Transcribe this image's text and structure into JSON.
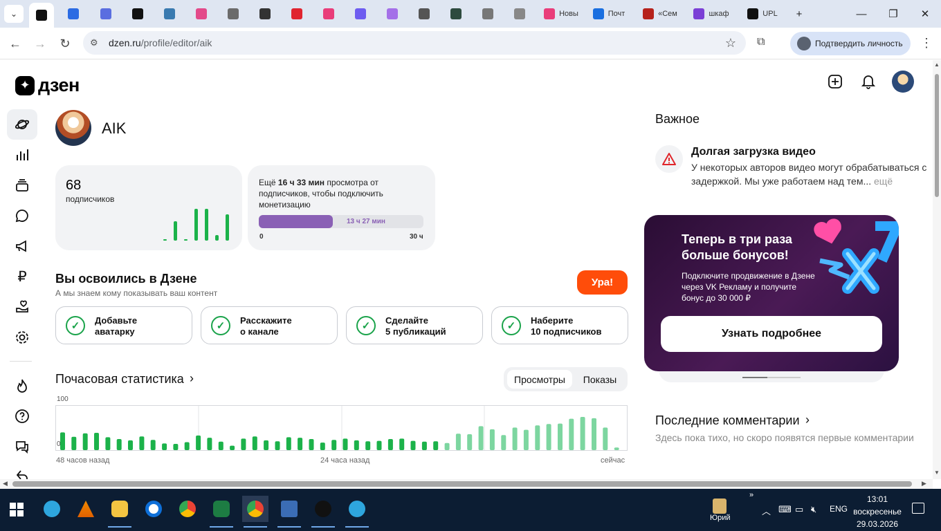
{
  "browser": {
    "tabs": [
      {
        "label": "",
        "color": "#111111"
      },
      {
        "label": "",
        "color": "#2b6be3"
      },
      {
        "label": "",
        "color": "#5a6ee0"
      },
      {
        "label": "",
        "color": "#111111"
      },
      {
        "label": "",
        "color": "#3a7ab0"
      },
      {
        "label": "",
        "color": "#e34a8a"
      },
      {
        "label": "",
        "color": "#6b6b6b"
      },
      {
        "label": "",
        "color": "#333333"
      },
      {
        "label": "",
        "color": "#e0242f"
      },
      {
        "label": "",
        "color": "#e93d7a"
      },
      {
        "label": "",
        "color": "#6d5cf0"
      },
      {
        "label": "",
        "color": "#a470e8"
      },
      {
        "label": "",
        "color": "#555555"
      },
      {
        "label": "",
        "color": "#2e4b3f"
      },
      {
        "label": "",
        "color": "#777777"
      },
      {
        "label": "",
        "color": "#888888"
      },
      {
        "label": "Новы",
        "color": "#e93d7a"
      },
      {
        "label": "Почт",
        "color": "#1a6fe0"
      },
      {
        "label": "«Сем",
        "color": "#b6221b"
      },
      {
        "label": "шкаф",
        "color": "#7b3fd6"
      },
      {
        "label": "UPL",
        "color": "#111111"
      }
    ],
    "url_host": "dzen.ru",
    "url_path": "/profile/editor/aik",
    "verify_label": "Подтвердить личность"
  },
  "header": {
    "logo_text": "дзен"
  },
  "profile": {
    "name": "AIK"
  },
  "subscribers": {
    "count": "68",
    "label": "подписчиков",
    "bars": [
      0.05,
      0.6,
      0.05,
      1.0,
      1.0,
      0.18,
      0.82
    ]
  },
  "monetization": {
    "text_pre": "Ещё ",
    "text_bold": "16 ч 33 мин",
    "text_post": " просмотра от подписчиков, чтобы подключить монетизацию",
    "progress_fraction": 0.449,
    "progress_label": "13 ч 27 мин",
    "min_label": "0",
    "max_label": "30 ч"
  },
  "onboarding": {
    "title": "Вы освоились в Дзене",
    "subtitle": "А мы знаем кому показывать ваш контент",
    "button": "Ура!",
    "tasks": [
      {
        "line1": "Добавьте",
        "line2": "аватарку"
      },
      {
        "line1": "Расскажите",
        "line2": "о канале"
      },
      {
        "line1": "Сделайте",
        "line2": "5 публикаций"
      },
      {
        "line1": "Наберите",
        "line2": "10 подписчиков"
      }
    ]
  },
  "hourly": {
    "title": "Почасовая статистика",
    "toggle": [
      "Просмотры",
      "Показы"
    ],
    "x_labels": [
      "48 часов назад",
      "24 часа назад",
      "сейчас"
    ]
  },
  "chart_data": {
    "type": "bar",
    "title": "Почасовая статистика",
    "xlabel": "",
    "ylabel": "",
    "ylim": [
      0,
      100
    ],
    "y_ticks": [
      "100",
      "0"
    ],
    "x_tick_labels": [
      "48 часов назад",
      "24 часа назад",
      "сейчас"
    ],
    "colors": {
      "past": "#1cb24a",
      "recent": "#7dd6a0"
    },
    "values": [
      40,
      30,
      38,
      39,
      29,
      25,
      22,
      31,
      23,
      15,
      14,
      18,
      33,
      28,
      19,
      10,
      26,
      31,
      22,
      20,
      29,
      28,
      25,
      17,
      23,
      26,
      22,
      20,
      21,
      25,
      26,
      21,
      19,
      20,
      16,
      37,
      36,
      54,
      47,
      34,
      51,
      46,
      56,
      59,
      60,
      71,
      75,
      72,
      51,
      6
    ]
  },
  "important": {
    "title": "Важное",
    "head": "Долгая загрузка видео",
    "body": "У некоторых авторов видео могут обрабатываться с задержкой. Мы уже работаем над тем...",
    "more": "ещё"
  },
  "promo": {
    "headline": "Теперь в три раза больше бонусов!",
    "body": "Подключите продвижение в Дзене через VK Рекламу и получите бонус до 30 000 ₽",
    "button": "Узнать подробнее"
  },
  "comments": {
    "title": "Последние комментарии",
    "empty": "Здесь пока тихо, но скоро появятся первые комментарии"
  },
  "taskbar": {
    "user": "Юрий",
    "lang": "ENG",
    "time": "13:01",
    "day": "воскресенье",
    "date": "29.03.2026"
  }
}
